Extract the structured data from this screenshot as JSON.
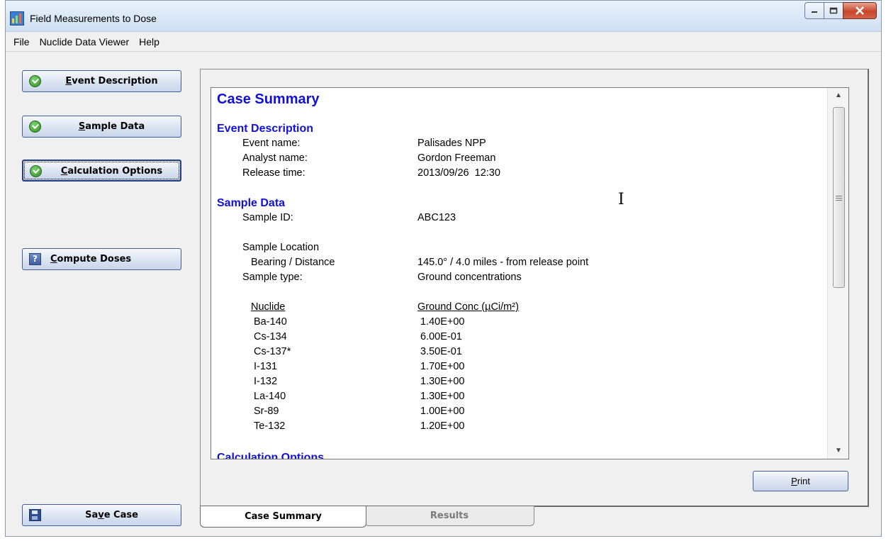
{
  "window": {
    "title": "Field Measurements to Dose"
  },
  "menu": [
    "File",
    "Nuclide Data Viewer",
    "Help"
  ],
  "sidebar": {
    "event_description": {
      "label": "Event Description",
      "mnemonic": "E",
      "rest": "vent Description"
    },
    "sample_data": {
      "label": "Sample Data",
      "mnemonic": "S",
      "rest": "ample Data"
    },
    "calculation_options": {
      "label": "Calculation Options",
      "mnemonic": "C",
      "rest": "alculation Options"
    },
    "compute_doses": {
      "label": "Compute Doses",
      "mnemonic": "C",
      "rest": "ompute Doses"
    },
    "save_case": {
      "label": "Save Case",
      "pre": "Sa",
      "mnemonic": "v",
      "rest": "e Case"
    }
  },
  "report": {
    "title": "Case Summary",
    "event_description": {
      "heading": "Event Description",
      "rows": [
        {
          "label": "Event name:",
          "value": "Palisades NPP"
        },
        {
          "label": "Analyst name:",
          "value": "Gordon Freeman"
        },
        {
          "label": "Release time:",
          "value": "2013/09/26  12:30"
        }
      ]
    },
    "sample_data": {
      "heading": "Sample Data",
      "sample_id_label": "Sample ID:",
      "sample_id_value": "ABC123",
      "location_label": "Sample Location",
      "bearing_label": "Bearing / Distance",
      "bearing_value": "145.0° / 4.0 miles - from release point",
      "type_label": "Sample type:",
      "type_value": "Ground concentrations",
      "table_headers": [
        "Nuclide",
        "Ground Conc (µCi/m²)"
      ],
      "table_rows": [
        [
          "Ba-140",
          "1.40E+00"
        ],
        [
          "Cs-134",
          "6.00E-01"
        ],
        [
          "Cs-137*",
          "3.50E-01"
        ],
        [
          "I-131",
          "1.70E+00"
        ],
        [
          "I-132",
          "1.30E+00"
        ],
        [
          "La-140",
          "1.30E+00"
        ],
        [
          "Sr-89",
          "1.00E+00"
        ],
        [
          "Te-132",
          "1.20E+00"
        ]
      ]
    },
    "calculation_options": {
      "heading": "Calculation Options"
    }
  },
  "print_button": {
    "label": "Print",
    "mnemonic": "P",
    "rest": "rint"
  },
  "tabs": [
    "Case Summary",
    "Results"
  ],
  "colors": {
    "heading_blue": "#1010d8",
    "check_green": "#2f8f2a",
    "close_red": "#c9452c"
  },
  "icons": {
    "app": "app-icon",
    "check": "check-icon",
    "help": "question-icon",
    "save": "floppy-disk-icon"
  }
}
